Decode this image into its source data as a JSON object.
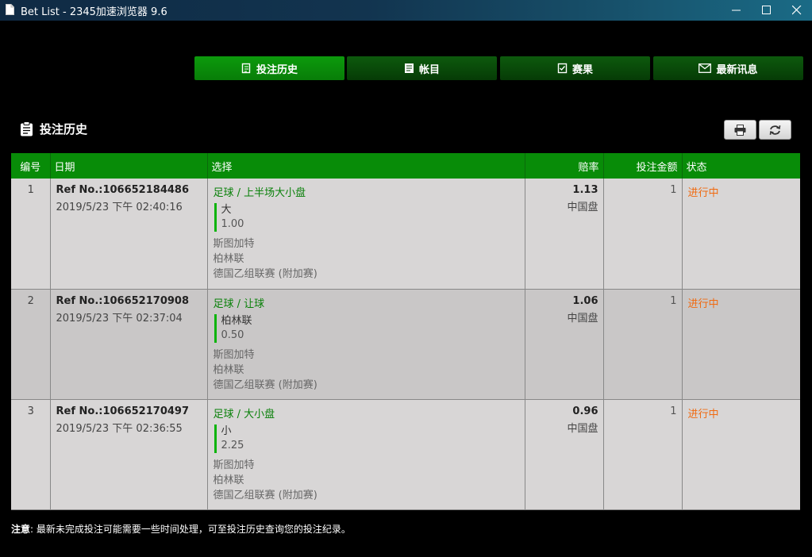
{
  "window": {
    "title": "Bet List - 2345加速浏览器 9.6"
  },
  "tabs": [
    {
      "label": "投注历史",
      "icon": "bet-history-icon",
      "active": true
    },
    {
      "label": "帐目",
      "icon": "statement-icon",
      "active": false
    },
    {
      "label": "赛果",
      "icon": "results-icon",
      "active": false
    },
    {
      "label": "最新讯息",
      "icon": "mail-icon",
      "active": false
    }
  ],
  "heading": "投注历史",
  "table": {
    "headers": {
      "no": "编号",
      "date": "日期",
      "selection": "选择",
      "odds": "赔率",
      "stake": "投注金额",
      "status": "状态"
    },
    "rows": [
      {
        "no": "1",
        "ref": "Ref No.:106652184486",
        "datetime": "2019/5/23 下午 02:40:16",
        "sport": "足球 / 上半场大小盘",
        "pick": "大",
        "handicap": "1.00",
        "home": "斯图加特",
        "away": "柏林联",
        "league": "德国乙组联赛 (附加赛)",
        "odds": "1.13",
        "odds_type": "中国盘",
        "stake": "1",
        "status": "进行中"
      },
      {
        "no": "2",
        "ref": "Ref No.:106652170908",
        "datetime": "2019/5/23 下午 02:37:04",
        "sport": "足球 / 让球",
        "pick": "柏林联",
        "handicap": "0.50",
        "home": "斯图加特",
        "away": "柏林联",
        "league": "德国乙组联赛 (附加赛)",
        "odds": "1.06",
        "odds_type": "中国盘",
        "stake": "1",
        "status": "进行中"
      },
      {
        "no": "3",
        "ref": "Ref No.:106652170497",
        "datetime": "2019/5/23 下午 02:36:55",
        "sport": "足球 / 大小盘",
        "pick": "小",
        "handicap": "2.25",
        "home": "斯图加特",
        "away": "柏林联",
        "league": "德国乙组联赛 (附加赛)",
        "odds": "0.96",
        "odds_type": "中国盘",
        "stake": "1",
        "status": "进行中"
      }
    ]
  },
  "note": {
    "label": "注意",
    "text": ": 最新未完成投注可能需要一些时间处理，可至投注历史查询您的投注纪录。"
  },
  "colors": {
    "tab_active": "#0c9a0c",
    "tab": "#0a4f0a",
    "header": "#088c08",
    "status": "#f06a10",
    "accent_bar": "#0ab40a"
  }
}
